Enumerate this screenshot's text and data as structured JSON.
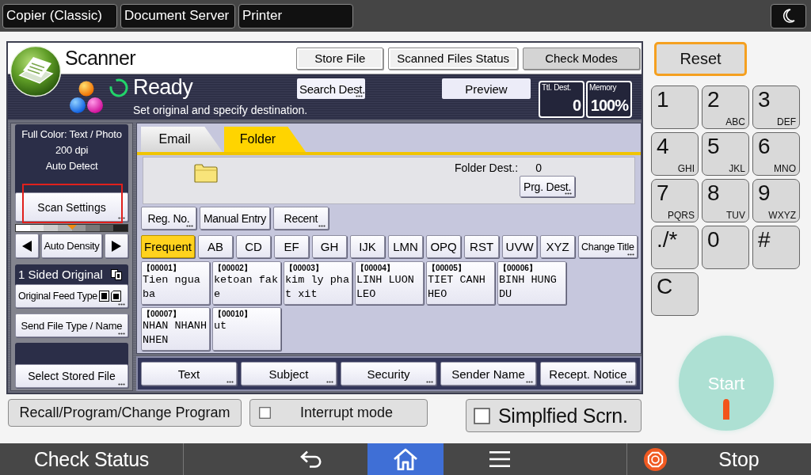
{
  "top_tabs": [
    {
      "label": "Copier (Classic)",
      "selected": false
    },
    {
      "label": "Document Server",
      "selected": false
    },
    {
      "label": "Printer",
      "selected": false
    }
  ],
  "scanner": {
    "title": "Scanner",
    "header_buttons": [
      {
        "label": "Store File",
        "kind": "plain"
      },
      {
        "label": "Scanned Files Status",
        "kind": "plain"
      },
      {
        "label": "Check Modes",
        "kind": "mode"
      }
    ],
    "status": {
      "text": "Ready",
      "message": "Set original and specify destination."
    },
    "search_button": {
      "label": "Search Dest.",
      "more": true
    },
    "preview": "Preview",
    "counters": [
      {
        "label": "Ttl. Dest.",
        "value": "0"
      },
      {
        "label": "Memory",
        "value": "100%"
      }
    ]
  },
  "left_panel": {
    "summary": [
      "Full Color: Text / Photo",
      "200 dpi",
      "Auto Detect"
    ],
    "scan_settings": {
      "label": "Scan Settings",
      "more": true,
      "highlighted": true
    },
    "density": {
      "level": 0.5,
      "label": "Auto Density"
    },
    "original": {
      "label": "1 Sided Original",
      "button": {
        "label": "Original Feed Type",
        "more": true
      }
    },
    "send_file": {
      "label": "Send File Type / Name",
      "more": true
    },
    "stored_file": {
      "label": "Select Stored File",
      "more": true
    }
  },
  "destination_tabs": [
    {
      "label": "Email",
      "selected": false
    },
    {
      "label": "Folder",
      "selected": true
    }
  ],
  "folder_dest": {
    "label": "Folder Dest.:",
    "count": "0",
    "button": {
      "label": "Prg. Dest.",
      "more": true
    }
  },
  "entry_buttons": [
    {
      "label": "Reg. No.",
      "more": true
    },
    {
      "label": "Manual Entry",
      "more": false
    },
    {
      "label": "Recent",
      "more": true
    }
  ],
  "index_tabs": [
    {
      "label": "Frequent",
      "selected": true
    },
    {
      "label": "AB",
      "selected": false
    },
    {
      "label": "CD",
      "selected": false
    },
    {
      "label": "EF",
      "selected": false
    },
    {
      "label": "GH",
      "selected": false
    },
    {
      "label": "IJK",
      "selected": false
    },
    {
      "label": "LMN",
      "selected": false
    },
    {
      "label": "OPQ",
      "selected": false
    },
    {
      "label": "RST",
      "selected": false
    },
    {
      "label": "UVW",
      "selected": false
    },
    {
      "label": "XYZ",
      "selected": false
    }
  ],
  "change_title": {
    "label": "Change Title",
    "more": true
  },
  "destinations": [
    {
      "number": "【00001】",
      "name": "Tien ngua ba"
    },
    {
      "number": "【00002】",
      "name": "ketoan fake"
    },
    {
      "number": "【00003】",
      "name": "kim ly phat xit"
    },
    {
      "number": "【00004】",
      "name": "LINH LUON LEO"
    },
    {
      "number": "【00005】",
      "name": "TIET CANH HEO"
    },
    {
      "number": "【00006】",
      "name": "BINH HUNG DU"
    },
    {
      "number": "【00007】",
      "name": "NHAN NHANH NHEN"
    },
    {
      "number": "【00010】",
      "name": "ut"
    }
  ],
  "options": [
    {
      "label": "Text",
      "more": true
    },
    {
      "label": "Subject",
      "more": true
    },
    {
      "label": "Security",
      "more": true
    },
    {
      "label": "Sender Name",
      "more": true
    },
    {
      "label": "Recept. Notice",
      "more": true
    }
  ],
  "footer_buttons": {
    "recall": "Recall/Program/Change Program",
    "interrupt": {
      "label": "Interrupt mode",
      "checked": false
    },
    "simplified": {
      "label": "Simplfied Scrn.",
      "checked": false
    }
  },
  "keypad": {
    "reset": "Reset",
    "keys": [
      {
        "digit": "1"
      },
      {
        "digit": "2",
        "letters": "ABC"
      },
      {
        "digit": "3",
        "letters": "DEF"
      },
      {
        "digit": "4",
        "letters": "GHI"
      },
      {
        "digit": "5",
        "letters": "JKL"
      },
      {
        "digit": "6",
        "letters": "MNO"
      },
      {
        "digit": "7",
        "letters": "PQRS"
      },
      {
        "digit": "8",
        "letters": "TUV"
      },
      {
        "digit": "9",
        "letters": "WXYZ"
      },
      {
        "digit": "./*"
      },
      {
        "digit": "0"
      },
      {
        "digit": "#"
      },
      {
        "digit": "C"
      }
    ],
    "start": "Start"
  },
  "nav": {
    "check_status": "Check Status",
    "items": [
      {
        "kind": "back",
        "selected": false
      },
      {
        "kind": "home",
        "selected": true
      },
      {
        "kind": "menu",
        "selected": false
      }
    ],
    "stop": "Stop"
  }
}
